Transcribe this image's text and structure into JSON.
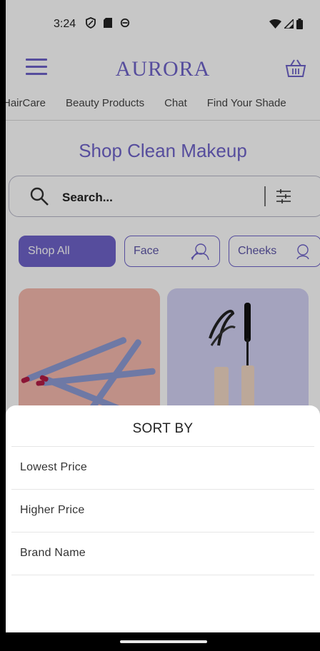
{
  "status_bar": {
    "time": "3:24"
  },
  "header": {
    "brand": "AURORA"
  },
  "nav": {
    "items": [
      "HairCare",
      "Beauty Products",
      "Chat",
      "Find Your Shade"
    ]
  },
  "page": {
    "title": "Shop Clean Makeup"
  },
  "search": {
    "placeholder": "Search..."
  },
  "chips": {
    "items": [
      "Shop All",
      "Face",
      "Cheeks"
    ]
  },
  "sort_sheet": {
    "title": "SORT BY",
    "options": [
      "Lowest Price",
      "Higher Price",
      "Brand Name"
    ]
  },
  "colors": {
    "accent": "#6f63c9",
    "card_pink": "#f5b9ad",
    "card_lavender": "#d2d1f4"
  }
}
